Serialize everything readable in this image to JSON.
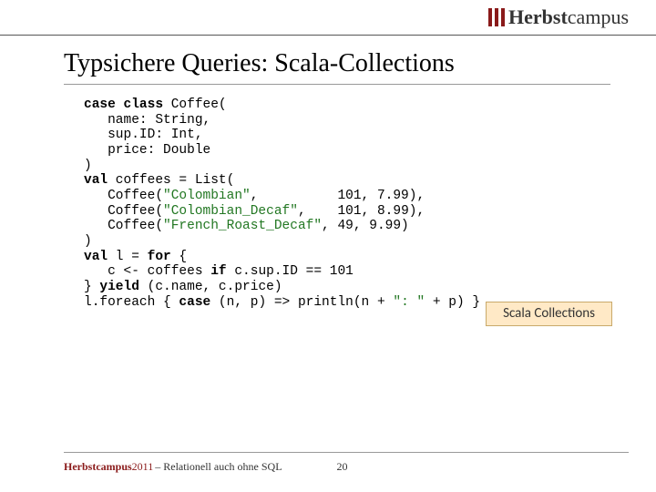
{
  "header": {
    "logo_text_bold": "Herbst",
    "logo_text_rest": "campus"
  },
  "title": "Typsichere Queries: Scala-Collections",
  "code": {
    "l1": "case class Coffee(",
    "l2": "   name: String,",
    "l3": "   sup.ID: Int,",
    "l4": "   price: Double",
    "l5": ")",
    "l6": "",
    "l7": "val coffees = List(",
    "l8a": "   Coffee(",
    "l8b": "\"Colombian\"",
    "l8c": ",          101, 7.99),",
    "l9a": "   Coffee(",
    "l9b": "\"Colombian_Decaf\"",
    "l9c": ",    101, 8.99),",
    "l10a": "   Coffee(",
    "l10b": "\"French_Roast_Decaf\"",
    "l10c": ", 49, 9.99)",
    "l11": ")",
    "l12": "",
    "l13": "val l = for {",
    "l14": "   c <- coffees if c.sup.ID == 101",
    "l15": "} yield (c.name, c.price)",
    "l16": "",
    "l17a": "l.foreach { ",
    "l17b": "case",
    "l17c": " (n, p) => println(n + ",
    "l17d": "\": \"",
    "l17e": " + p) }"
  },
  "badge": "Scala Collections",
  "footer": {
    "brand": "Herbstcampus ",
    "year": "2011",
    "subtitle": " – Relationell auch ohne SQL",
    "page": "20"
  }
}
